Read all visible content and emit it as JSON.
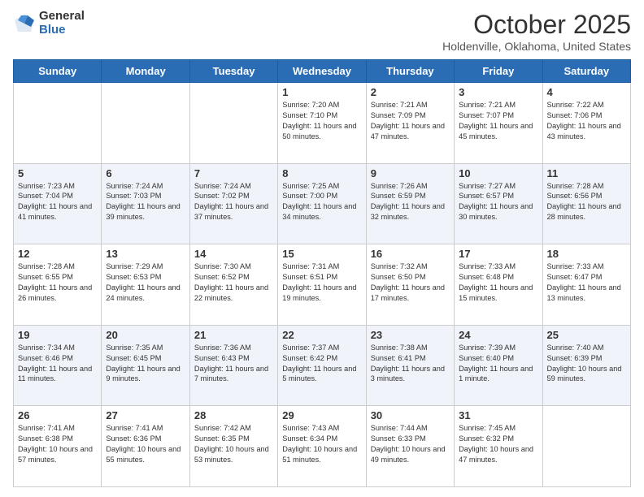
{
  "logo": {
    "general": "General",
    "blue": "Blue"
  },
  "title": "October 2025",
  "location": "Holdenville, Oklahoma, United States",
  "days_of_week": [
    "Sunday",
    "Monday",
    "Tuesday",
    "Wednesday",
    "Thursday",
    "Friday",
    "Saturday"
  ],
  "weeks": [
    [
      {
        "day": "",
        "info": ""
      },
      {
        "day": "",
        "info": ""
      },
      {
        "day": "",
        "info": ""
      },
      {
        "day": "1",
        "info": "Sunrise: 7:20 AM\nSunset: 7:10 PM\nDaylight: 11 hours\nand 50 minutes."
      },
      {
        "day": "2",
        "info": "Sunrise: 7:21 AM\nSunset: 7:09 PM\nDaylight: 11 hours\nand 47 minutes."
      },
      {
        "day": "3",
        "info": "Sunrise: 7:21 AM\nSunset: 7:07 PM\nDaylight: 11 hours\nand 45 minutes."
      },
      {
        "day": "4",
        "info": "Sunrise: 7:22 AM\nSunset: 7:06 PM\nDaylight: 11 hours\nand 43 minutes."
      }
    ],
    [
      {
        "day": "5",
        "info": "Sunrise: 7:23 AM\nSunset: 7:04 PM\nDaylight: 11 hours\nand 41 minutes."
      },
      {
        "day": "6",
        "info": "Sunrise: 7:24 AM\nSunset: 7:03 PM\nDaylight: 11 hours\nand 39 minutes."
      },
      {
        "day": "7",
        "info": "Sunrise: 7:24 AM\nSunset: 7:02 PM\nDaylight: 11 hours\nand 37 minutes."
      },
      {
        "day": "8",
        "info": "Sunrise: 7:25 AM\nSunset: 7:00 PM\nDaylight: 11 hours\nand 34 minutes."
      },
      {
        "day": "9",
        "info": "Sunrise: 7:26 AM\nSunset: 6:59 PM\nDaylight: 11 hours\nand 32 minutes."
      },
      {
        "day": "10",
        "info": "Sunrise: 7:27 AM\nSunset: 6:57 PM\nDaylight: 11 hours\nand 30 minutes."
      },
      {
        "day": "11",
        "info": "Sunrise: 7:28 AM\nSunset: 6:56 PM\nDaylight: 11 hours\nand 28 minutes."
      }
    ],
    [
      {
        "day": "12",
        "info": "Sunrise: 7:28 AM\nSunset: 6:55 PM\nDaylight: 11 hours\nand 26 minutes."
      },
      {
        "day": "13",
        "info": "Sunrise: 7:29 AM\nSunset: 6:53 PM\nDaylight: 11 hours\nand 24 minutes."
      },
      {
        "day": "14",
        "info": "Sunrise: 7:30 AM\nSunset: 6:52 PM\nDaylight: 11 hours\nand 22 minutes."
      },
      {
        "day": "15",
        "info": "Sunrise: 7:31 AM\nSunset: 6:51 PM\nDaylight: 11 hours\nand 19 minutes."
      },
      {
        "day": "16",
        "info": "Sunrise: 7:32 AM\nSunset: 6:50 PM\nDaylight: 11 hours\nand 17 minutes."
      },
      {
        "day": "17",
        "info": "Sunrise: 7:33 AM\nSunset: 6:48 PM\nDaylight: 11 hours\nand 15 minutes."
      },
      {
        "day": "18",
        "info": "Sunrise: 7:33 AM\nSunset: 6:47 PM\nDaylight: 11 hours\nand 13 minutes."
      }
    ],
    [
      {
        "day": "19",
        "info": "Sunrise: 7:34 AM\nSunset: 6:46 PM\nDaylight: 11 hours\nand 11 minutes."
      },
      {
        "day": "20",
        "info": "Sunrise: 7:35 AM\nSunset: 6:45 PM\nDaylight: 11 hours\nand 9 minutes."
      },
      {
        "day": "21",
        "info": "Sunrise: 7:36 AM\nSunset: 6:43 PM\nDaylight: 11 hours\nand 7 minutes."
      },
      {
        "day": "22",
        "info": "Sunrise: 7:37 AM\nSunset: 6:42 PM\nDaylight: 11 hours\nand 5 minutes."
      },
      {
        "day": "23",
        "info": "Sunrise: 7:38 AM\nSunset: 6:41 PM\nDaylight: 11 hours\nand 3 minutes."
      },
      {
        "day": "24",
        "info": "Sunrise: 7:39 AM\nSunset: 6:40 PM\nDaylight: 11 hours\nand 1 minute."
      },
      {
        "day": "25",
        "info": "Sunrise: 7:40 AM\nSunset: 6:39 PM\nDaylight: 10 hours\nand 59 minutes."
      }
    ],
    [
      {
        "day": "26",
        "info": "Sunrise: 7:41 AM\nSunset: 6:38 PM\nDaylight: 10 hours\nand 57 minutes."
      },
      {
        "day": "27",
        "info": "Sunrise: 7:41 AM\nSunset: 6:36 PM\nDaylight: 10 hours\nand 55 minutes."
      },
      {
        "day": "28",
        "info": "Sunrise: 7:42 AM\nSunset: 6:35 PM\nDaylight: 10 hours\nand 53 minutes."
      },
      {
        "day": "29",
        "info": "Sunrise: 7:43 AM\nSunset: 6:34 PM\nDaylight: 10 hours\nand 51 minutes."
      },
      {
        "day": "30",
        "info": "Sunrise: 7:44 AM\nSunset: 6:33 PM\nDaylight: 10 hours\nand 49 minutes."
      },
      {
        "day": "31",
        "info": "Sunrise: 7:45 AM\nSunset: 6:32 PM\nDaylight: 10 hours\nand 47 minutes."
      },
      {
        "day": "",
        "info": ""
      }
    ]
  ]
}
